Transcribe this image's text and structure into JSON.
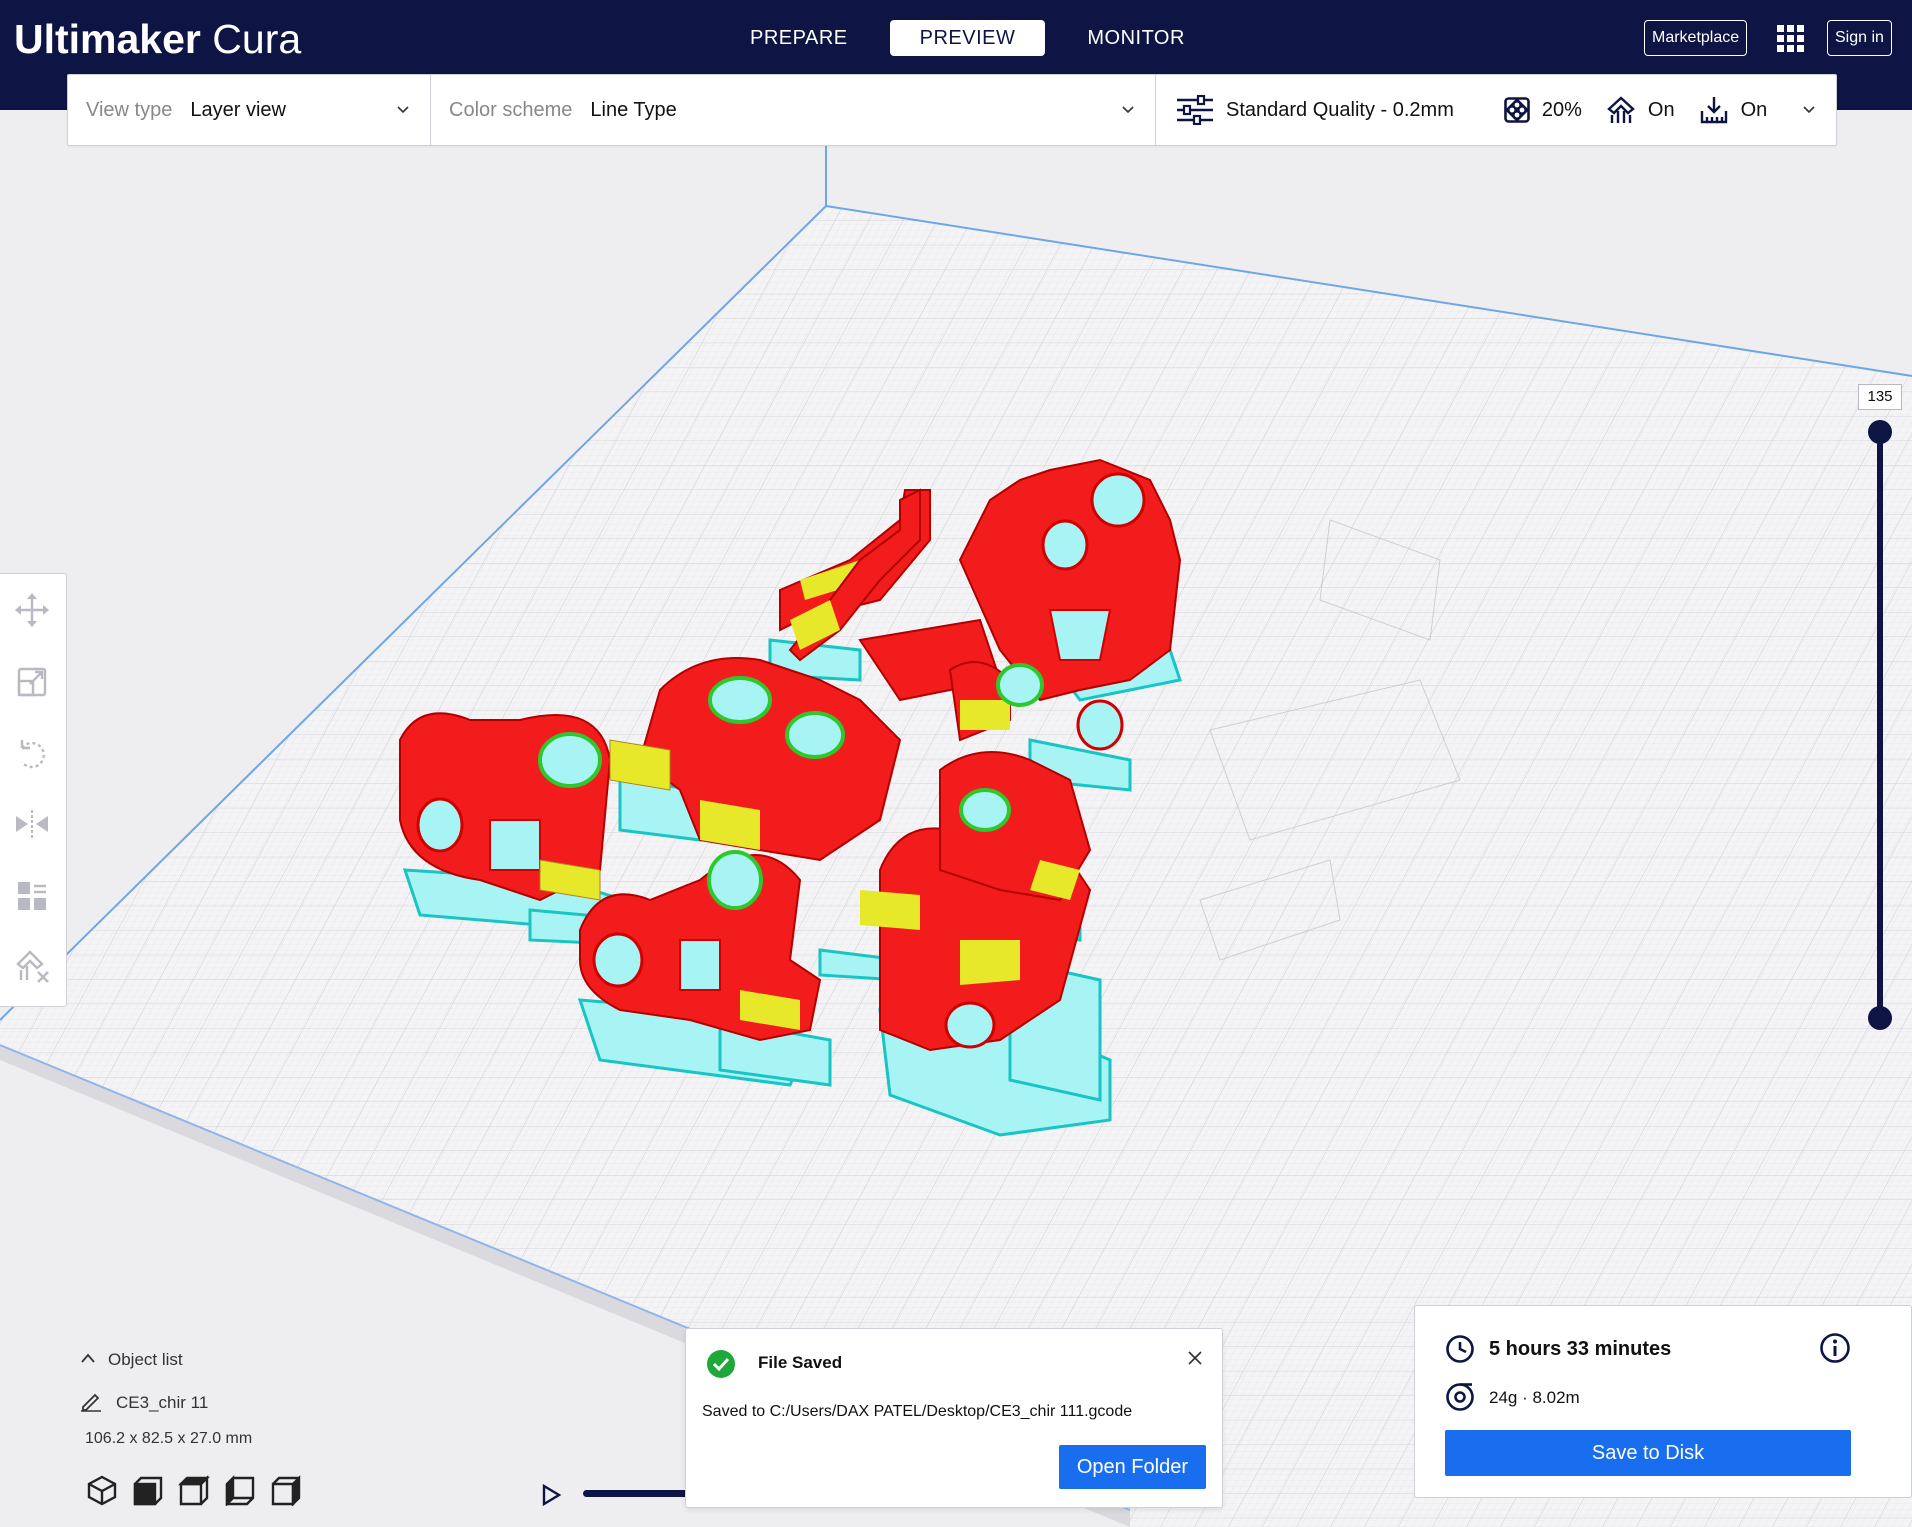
{
  "app": {
    "brand_bold": "Ultimaker",
    "brand_light": "Cura"
  },
  "header": {
    "tabs": [
      {
        "label": "PREPARE",
        "active": false
      },
      {
        "label": "PREVIEW",
        "active": true
      },
      {
        "label": "MONITOR",
        "active": false
      }
    ],
    "marketplace_label": "Marketplace",
    "signin_label": "Sign in"
  },
  "toolbar": {
    "view_type_label": "View type",
    "view_type_value": "Layer view",
    "color_scheme_label": "Color scheme",
    "color_scheme_value": "Line Type",
    "quality_label": "Standard Quality - 0.2mm",
    "infill_value": "20%",
    "support_value": "On",
    "adhesion_value": "On"
  },
  "layer_slider": {
    "current_layer": "135"
  },
  "object_list": {
    "title": "Object list",
    "item_name": "CE3_chir 11",
    "dimensions": "106.2 x 82.5 x 27.0 mm"
  },
  "notification": {
    "title": "File Saved",
    "message": "Saved to C:/Users/DAX PATEL/Desktop/CE3_chir 111.gcode",
    "button_label": "Open Folder"
  },
  "print_info": {
    "time": "5 hours 33 minutes",
    "material": "24g · 8.02m",
    "save_label": "Save to Disk"
  },
  "colors": {
    "header_bg": "#0e1545",
    "accent_blue": "#196ef0",
    "wall_red": "#f21c1c",
    "support_cyan": "#a8f4f4",
    "infill_yellow": "#e8e82a",
    "inner_green": "#30c030"
  },
  "icons": {
    "tools": [
      "move-icon",
      "scale-icon",
      "rotate-icon",
      "mirror-icon",
      "per-model-settings-icon",
      "support-blocker-icon"
    ],
    "view_cubes": [
      "3d-view-icon",
      "front-view-icon",
      "top-view-icon",
      "left-view-icon",
      "right-view-icon"
    ]
  }
}
